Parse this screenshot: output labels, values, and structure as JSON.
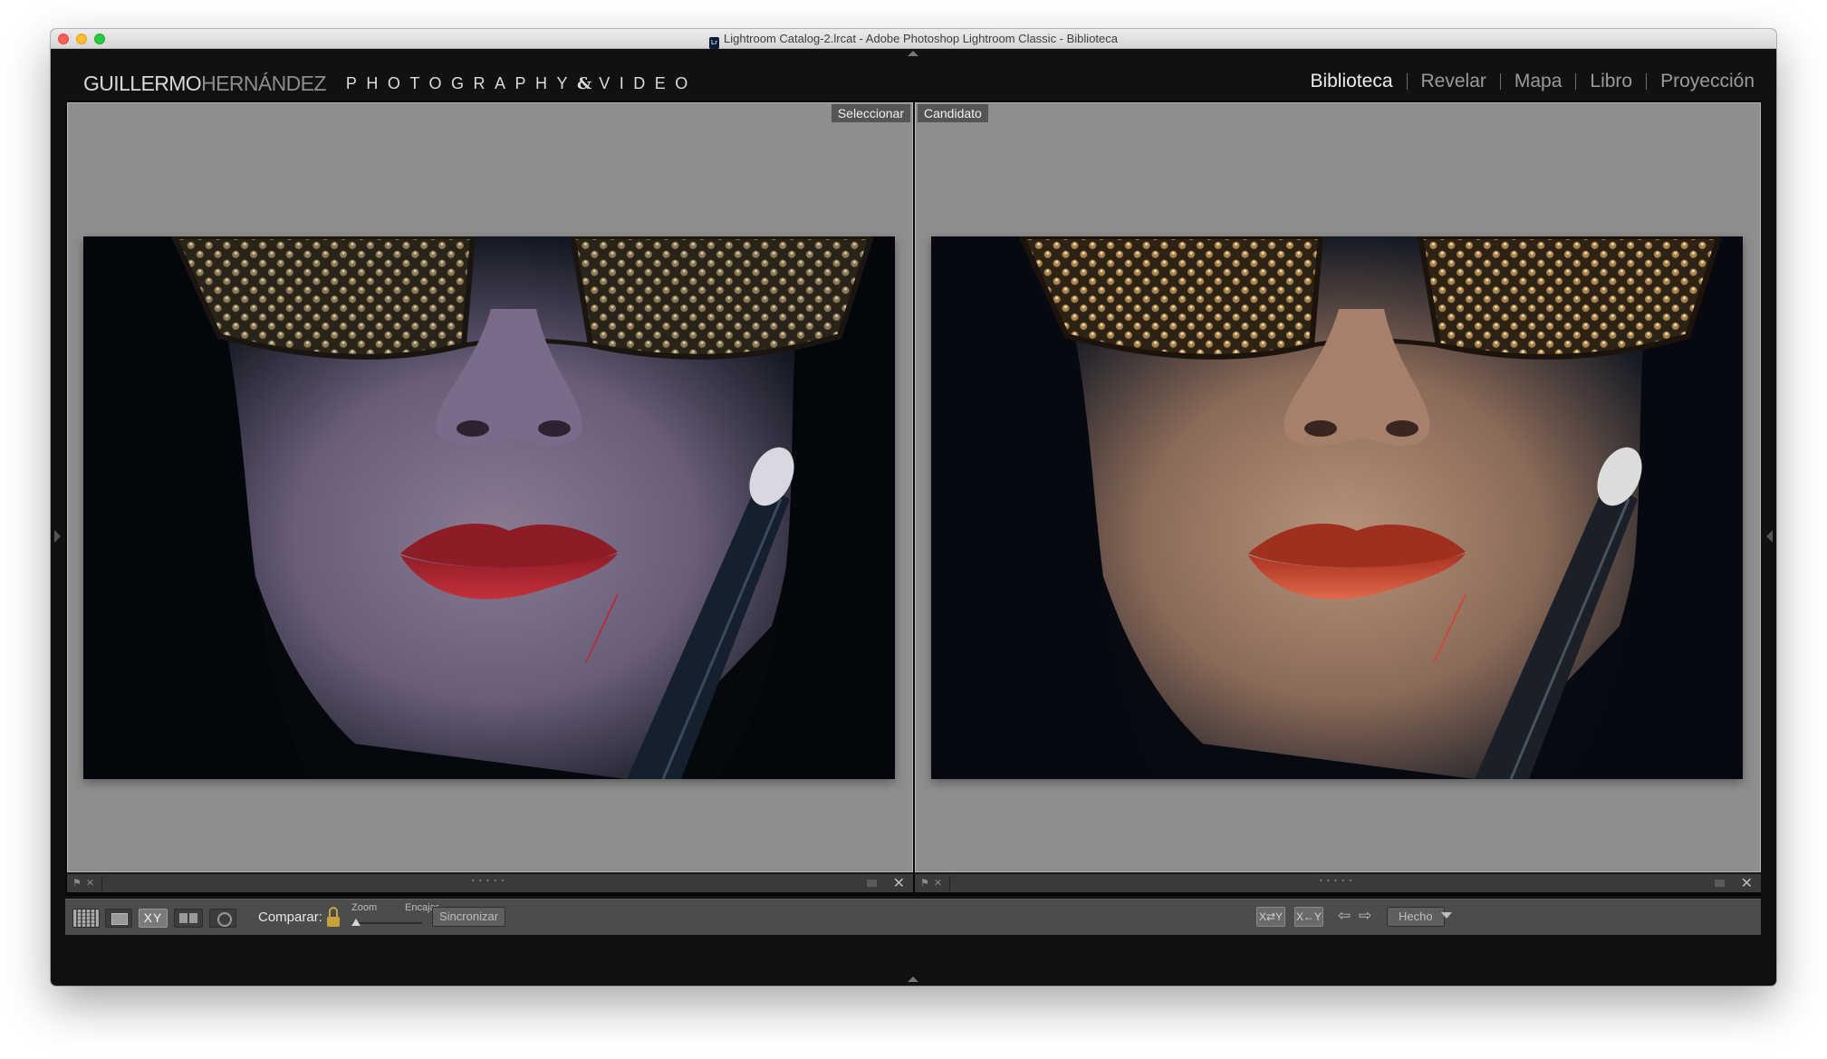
{
  "window": {
    "title": "Lightroom Catalog-2.lrcat - Adobe Photoshop Lightroom Classic - Biblioteca",
    "app_icon": "Lr"
  },
  "identity_plate": {
    "name_part1": "GUILLERMO",
    "name_part2": "HERNÁNDEZ",
    "tagline_part1": "PHOTOGRAPHY",
    "tagline_ampersand": "&",
    "tagline_part2": "VIDEO"
  },
  "modules": [
    {
      "label": "Biblioteca",
      "active": true
    },
    {
      "label": "Revelar",
      "active": false
    },
    {
      "label": "Mapa",
      "active": false
    },
    {
      "label": "Libro",
      "active": false
    },
    {
      "label": "Proyección",
      "active": false
    }
  ],
  "compare": {
    "left_label": "Seleccionar",
    "right_label": "Candidato"
  },
  "toolbar": {
    "compare_label": "Comparar:",
    "zoom_label": "Zoom",
    "fit_label": "Encajar",
    "sync_label": "Sincronizar",
    "xy_label": "XY",
    "done_label": "Hecho",
    "zoom_level": 0
  },
  "colors": {
    "active_module": "#ededed",
    "inactive_module": "#9a9a9a",
    "pane_background": "#8e8e8e",
    "lock": "#c9a23a"
  }
}
